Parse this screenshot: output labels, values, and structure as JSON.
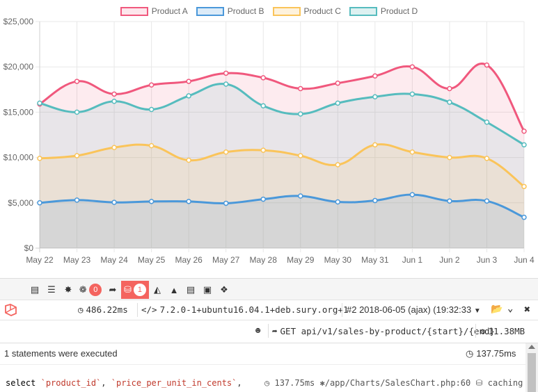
{
  "chart_data": {
    "type": "area",
    "categories": [
      "May 22",
      "May 23",
      "May 24",
      "May 25",
      "May 26",
      "May 27",
      "May 28",
      "May 29",
      "May 30",
      "May 31",
      "Jun 1",
      "Jun 2",
      "Jun 3",
      "Jun 4"
    ],
    "y_ticks": [
      "$0",
      "$5,000",
      "$10,000",
      "$15,000",
      "$20,000",
      "$25,000"
    ],
    "ylim": [
      0,
      25000
    ],
    "grid": true,
    "legend_position": "top",
    "title": "",
    "xlabel": "",
    "ylabel": "",
    "series": [
      {
        "name": "Product A",
        "color": "#f0587d",
        "values": [
          15900,
          18400,
          17000,
          18000,
          18400,
          19300,
          18800,
          17600,
          18200,
          19000,
          20000,
          17600,
          20200,
          12900
        ]
      },
      {
        "name": "Product B",
        "color": "#4a98da",
        "values": [
          5000,
          5300,
          5050,
          5150,
          5150,
          4950,
          5400,
          5750,
          5100,
          5250,
          5900,
          5200,
          5200,
          3400
        ]
      },
      {
        "name": "Product C",
        "color": "#fac45a",
        "values": [
          9900,
          10200,
          11100,
          11300,
          9700,
          10600,
          10800,
          10200,
          9200,
          11400,
          10600,
          10000,
          9900,
          6800
        ]
      },
      {
        "name": "Product D",
        "color": "#56bcbe",
        "values": [
          16000,
          15000,
          16200,
          15300,
          16800,
          18100,
          15700,
          14800,
          16000,
          16700,
          17000,
          16100,
          13900,
          11400
        ]
      }
    ]
  },
  "debugbar": {
    "tabs": [
      {
        "icon": "messages-icon"
      },
      {
        "icon": "timeline-icon"
      },
      {
        "icon": "exceptions-icon"
      },
      {
        "icon": "views-icon",
        "badge": "0"
      },
      {
        "icon": "route-icon"
      },
      {
        "icon": "queries-icon",
        "badge": "1",
        "active": true
      },
      {
        "icon": "mails-icon"
      },
      {
        "icon": "auth-icon"
      },
      {
        "icon": "gate-icon"
      },
      {
        "icon": "session-icon"
      },
      {
        "icon": "request-icon"
      }
    ],
    "duration": "486.22ms",
    "php_version": "7.2.0-1+ubuntu16.04.1+deb.sury.org+1",
    "request_select": "#2 2018-06-05 (ajax) (19:32:33",
    "request_method_path": "GET api/v1/sales-by-product/{start}/{end}",
    "memory": "11.38MB",
    "panel": {
      "summary": "1 statements were executed",
      "total_time": "137.75ms",
      "statement": {
        "kw": "select",
        "col1": "`product_id`",
        "col2": "`price_per_unit_in_cents`",
        "suffix": ",",
        "time": "137.75ms",
        "source": "/app/Charts/SalesChart.php:60",
        "connection": "caching"
      }
    }
  }
}
